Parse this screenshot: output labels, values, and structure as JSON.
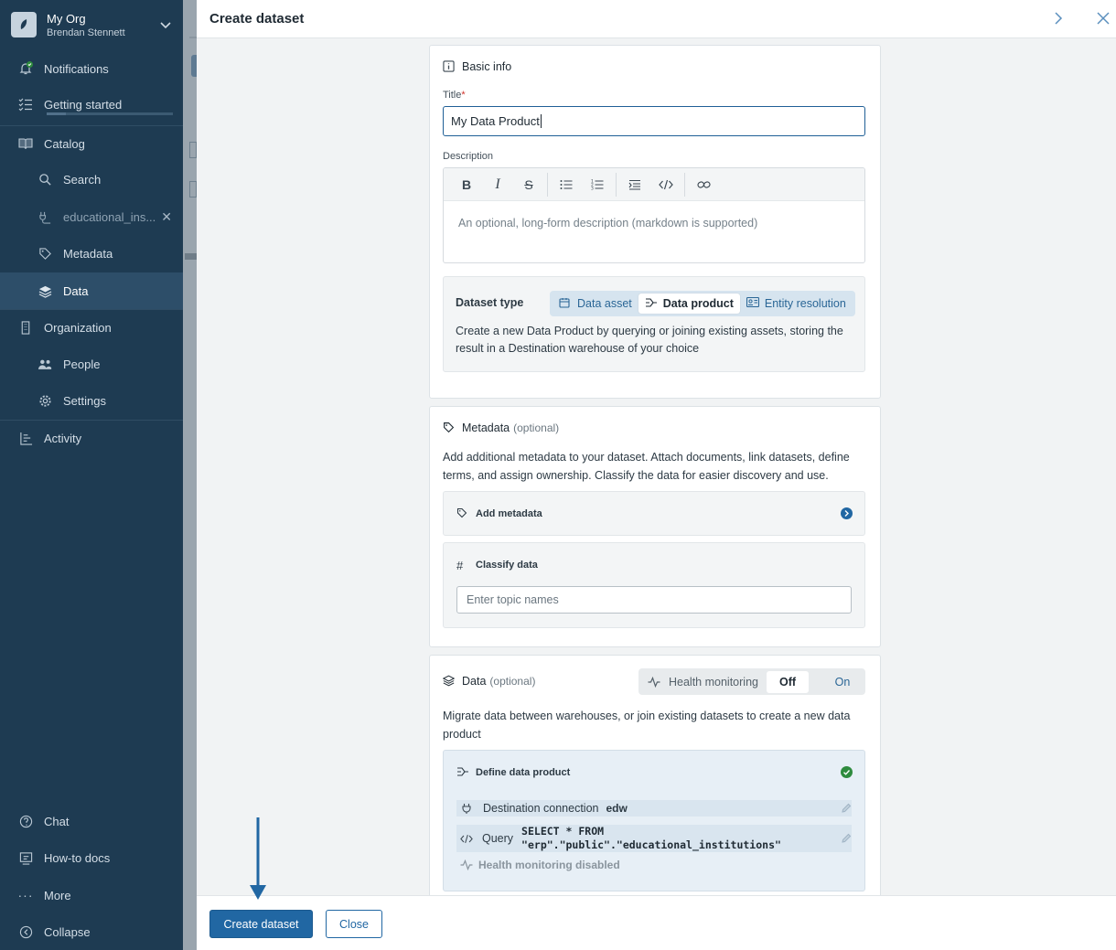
{
  "sidebar": {
    "org_name": "My Org",
    "user_name": "Brendan Stennett",
    "items": {
      "notifications": "Notifications",
      "getting_started": "Getting started",
      "catalog": "Catalog",
      "search": "Search",
      "educational": "educational_ins...",
      "metadata": "Metadata",
      "data": "Data",
      "organization": "Organization",
      "people": "People",
      "settings": "Settings",
      "activity": "Activity",
      "chat": "Chat",
      "howto": "How-to docs",
      "more": "More",
      "collapse": "Collapse"
    },
    "getting_started_progress": 0.15
  },
  "panel": {
    "title": "Create dataset"
  },
  "basic_info": {
    "heading": "Basic info",
    "title_label": "Title",
    "required_mark": "*",
    "title_value": "My Data Product",
    "description_label": "Description",
    "description_placeholder": "An optional, long-form description (markdown is supported)",
    "dataset_type_label": "Dataset type",
    "dataset_types": [
      "Data asset",
      "Data product",
      "Entity resolution"
    ],
    "selected_type": "Data product",
    "type_description": "Create a new Data Product by querying or joining existing assets, storing the result in a Destination warehouse of your choice"
  },
  "metadata_section": {
    "heading": "Metadata",
    "optional": "(optional)",
    "description": "Add additional metadata to your dataset. Attach documents, link datasets, define terms, and assign ownership. Classify the data for easier discovery and use.",
    "add_metadata": "Add metadata",
    "classify_data": "Classify data",
    "topic_placeholder": "Enter topic names"
  },
  "data_section": {
    "heading": "Data",
    "optional": "(optional)",
    "health_monitoring_label": "Health monitoring",
    "off": "Off",
    "on": "On",
    "description": "Migrate data between warehouses, or join existing datasets to create a new data product",
    "define_title": "Define data product",
    "destination_label": "Destination connection",
    "destination_value": "edw",
    "query_label": "Query",
    "query_line1": "SELECT * FROM",
    "query_line2": "\"erp\".\"public\".\"educational_institutions\"",
    "health_disabled": "Health monitoring disabled"
  },
  "footer": {
    "create_button": "Create dataset",
    "close_button": "Close"
  },
  "colors": {
    "sidebar_bg": "#1e3b52",
    "primary": "#2167a3",
    "success": "#2e8b3e"
  }
}
